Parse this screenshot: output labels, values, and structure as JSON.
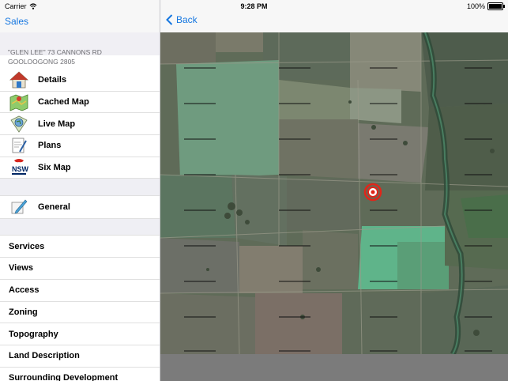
{
  "status": {
    "carrier": "Carrier",
    "time": "9:28 PM",
    "battery": "100%"
  },
  "sidebar": {
    "back_label": "Sales",
    "address": "\"GLEN LEE\" 73 CANNONS RD GOOLOOGONG 2805",
    "items": [
      {
        "label": "Details",
        "icon": "house-icon"
      },
      {
        "label": "Cached Map",
        "icon": "map-icon"
      },
      {
        "label": "Live Map",
        "icon": "globe-map-icon"
      },
      {
        "label": "Plans",
        "icon": "plans-icon"
      },
      {
        "label": "Six Map",
        "icon": "nsw-logo-icon"
      }
    ],
    "general": {
      "label": "General",
      "icon": "pencil-icon"
    },
    "sections": [
      "Services",
      "Views",
      "Access",
      "Zoning",
      "Topography",
      "Land Description",
      "Surrounding Development"
    ]
  },
  "map": {
    "back_label": "Back",
    "marker_icon": "target-icon"
  }
}
